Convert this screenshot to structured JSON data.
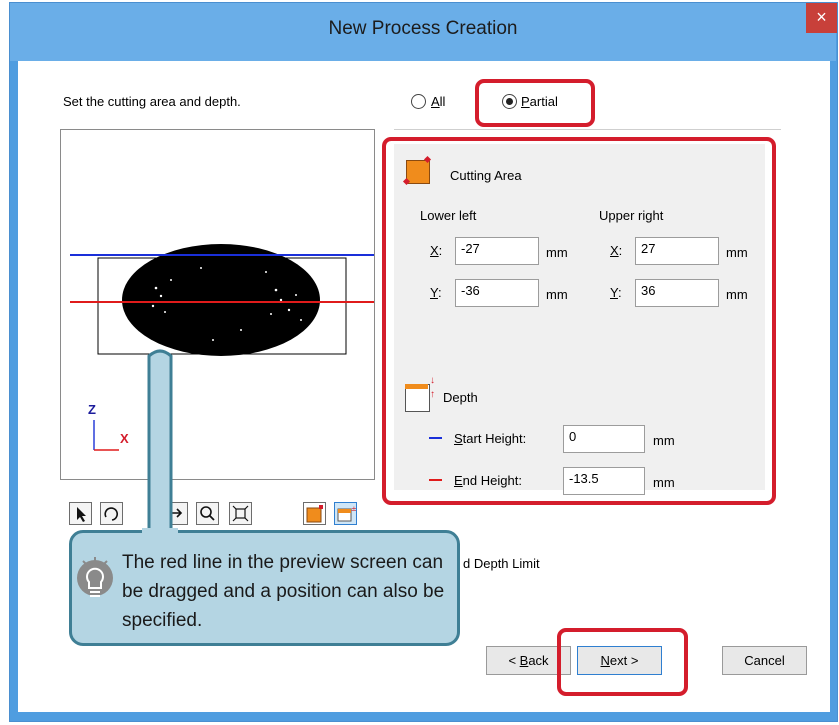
{
  "window": {
    "title": "New Process Creation",
    "close_label": "×"
  },
  "instruction": "Set the cutting area and depth.",
  "mode": {
    "all_label": "All",
    "partial_label": "Partial",
    "selected": "Partial"
  },
  "cutting_area": {
    "heading": "Cutting Area",
    "lower_left_label": "Lower left",
    "upper_right_label": "Upper right",
    "x_label": "X:",
    "y_label": "Y:",
    "unit": "mm",
    "lower_left_x": "-27",
    "lower_left_y": "-36",
    "upper_right_x": "27",
    "upper_right_y": "36"
  },
  "depth": {
    "heading": "Depth",
    "start_label": "Start Height:",
    "end_label": "End Height:",
    "start_value": "0",
    "end_value": "-13.5",
    "unit": "mm",
    "start_color": "#1a2fd9",
    "end_color": "#e01b1b"
  },
  "preview": {
    "axis_z": "Z",
    "axis_x": "X"
  },
  "depth_limit_partial": "d Depth Limit",
  "buttons": {
    "back": "< Back",
    "next": "Next >",
    "cancel": "Cancel"
  },
  "callout": {
    "text": "The red line in the preview screen can be dragged and a position can also be specified."
  },
  "colors": {
    "highlight": "#d41d2c",
    "callout_bg": "#b4d5e3",
    "title_bg": "#6aaee8"
  }
}
